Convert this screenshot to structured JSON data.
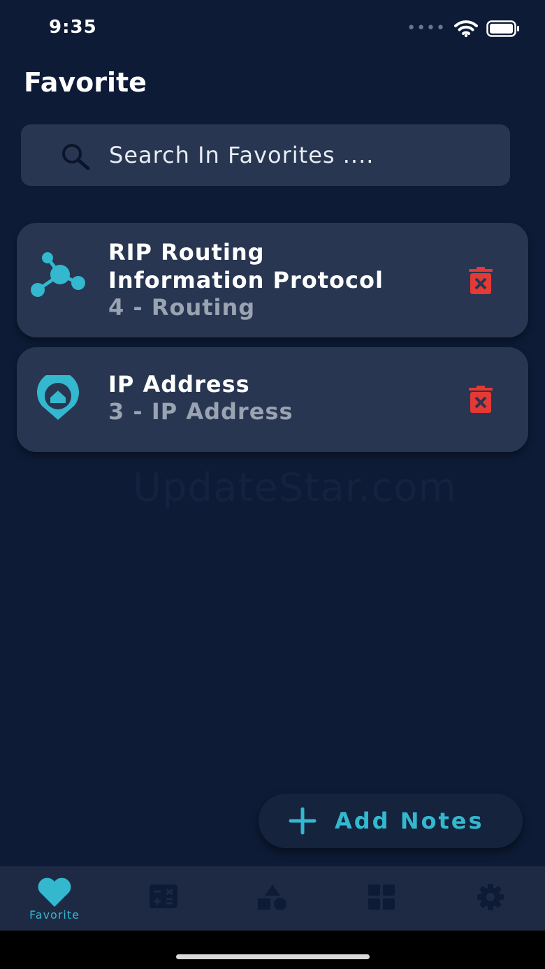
{
  "status_bar": {
    "time": "9:35",
    "signal": "••••"
  },
  "page": {
    "title": "Favorite"
  },
  "search": {
    "placeholder": "Search In Favorites ...."
  },
  "favorites": [
    {
      "title_line1": "RIP Routing",
      "title_line2": "Information Protocol",
      "subtitle": "4 - Routing",
      "icon": "network-nodes-icon"
    },
    {
      "title_line1": "IP Address",
      "subtitle": "3 - IP Address",
      "icon": "location-pin-home-icon"
    }
  ],
  "watermark": "UpdateStar.com",
  "fab": {
    "label": "Add Notes"
  },
  "tabs": [
    {
      "label": "Favorite",
      "icon": "heart-icon",
      "active": true
    },
    {
      "label": "",
      "icon": "calculator-icon",
      "active": false
    },
    {
      "label": "",
      "icon": "shapes-icon",
      "active": false
    },
    {
      "label": "",
      "icon": "grid-icon",
      "active": false
    },
    {
      "label": "",
      "icon": "gear-icon",
      "active": false
    }
  ],
  "colors": {
    "background": "#0d1b36",
    "card": "#283651",
    "accent": "#33b8cf",
    "delete": "#e53935",
    "tab_inactive": "#0d1b36"
  }
}
